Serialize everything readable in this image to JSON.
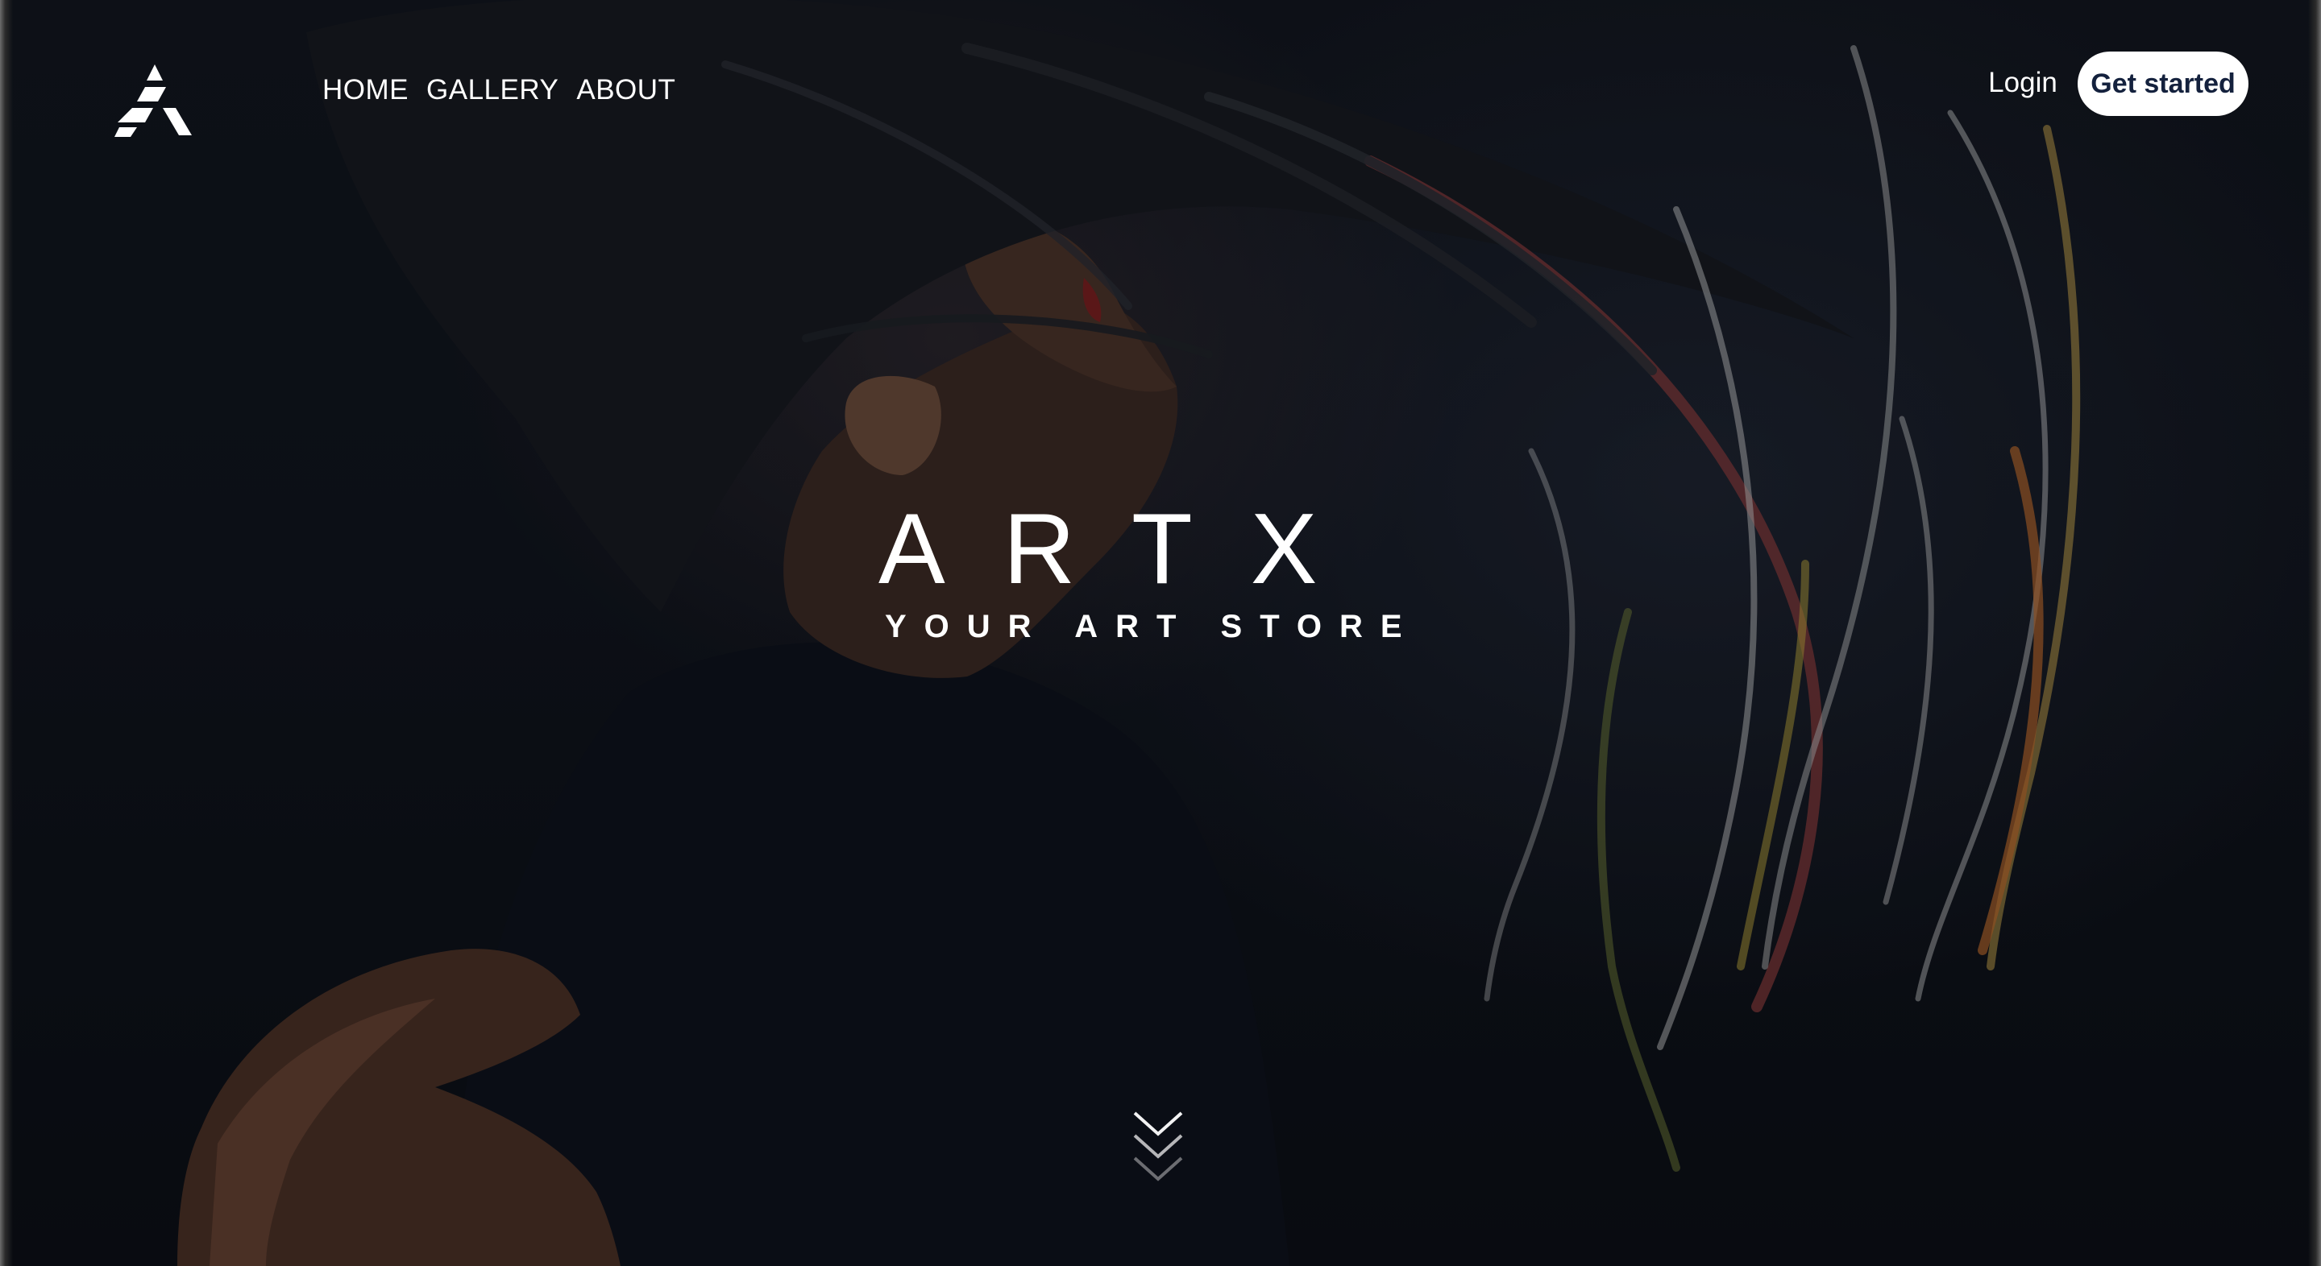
{
  "brand": {
    "logo_icon": "artx-triangle-logo-icon"
  },
  "nav": {
    "links": [
      {
        "label": "HOME"
      },
      {
        "label": "GALLERY"
      },
      {
        "label": "ABOUT"
      }
    ],
    "login_label": "Login",
    "cta_label": "Get started"
  },
  "hero": {
    "title": "ARTX",
    "subtitle": "YOUR ART STORE",
    "scroll_icon": "triple-chevron-down-icon"
  },
  "colors": {
    "background": "#0e1119",
    "text": "#ffffff",
    "cta_background": "#ffffff",
    "cta_text": "#14213d"
  }
}
